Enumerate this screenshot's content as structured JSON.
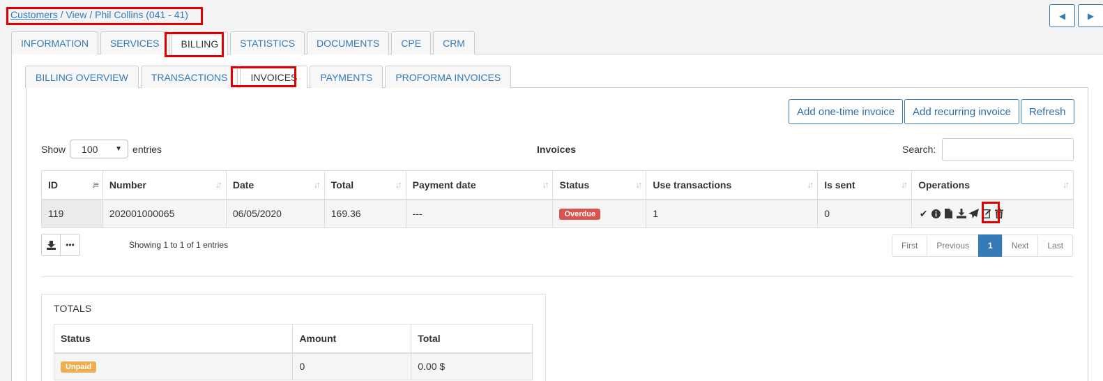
{
  "breadcrumb": {
    "link": "Customers",
    "rest": " / View / Phil Collins (041 - 41)"
  },
  "nav": {
    "prev_icon": "◀",
    "next_icon": "▶"
  },
  "tabs": [
    {
      "label": "INFORMATION"
    },
    {
      "label": "SERVICES"
    },
    {
      "label": "BILLING"
    },
    {
      "label": "STATISTICS"
    },
    {
      "label": "DOCUMENTS"
    },
    {
      "label": "CPE"
    },
    {
      "label": "CRM"
    }
  ],
  "subtabs": [
    {
      "label": "BILLING OVERVIEW"
    },
    {
      "label": "TRANSACTIONS"
    },
    {
      "label": "INVOICES"
    },
    {
      "label": "PAYMENTS"
    },
    {
      "label": "PROFORMA INVOICES"
    }
  ],
  "actions": {
    "add_one_time": "Add one-time invoice",
    "add_recurring": "Add recurring invoice",
    "refresh": "Refresh"
  },
  "table": {
    "show_label": "Show",
    "show_value": "100",
    "entries_label": "entries",
    "title": "Invoices",
    "search_label": "Search:",
    "search_value": "",
    "columns": [
      "ID",
      "Number",
      "Date",
      "Total",
      "Payment date",
      "Status",
      "Use transactions",
      "Is sent",
      "Operations"
    ],
    "rows": [
      {
        "id": "119",
        "number": "202001000065",
        "date": "06/05/2020",
        "total": "169.36",
        "payment_date": "---",
        "status": "Overdue",
        "use_transactions": "1",
        "is_sent": "0"
      }
    ],
    "info": "Showing 1 to 1 of 1 entries",
    "pagination": [
      "First",
      "Previous",
      "1",
      "Next",
      "Last"
    ]
  },
  "totals": {
    "title": "TOTALS",
    "columns": [
      "Status",
      "Amount",
      "Total"
    ],
    "rows": [
      {
        "status": "Unpaid",
        "amount": "0",
        "total": "0.00 $"
      }
    ]
  },
  "colors": {
    "link": "#337ab7",
    "overdue": "#d9534f",
    "unpaid": "#f0ad4e",
    "highlight": "#e00000"
  }
}
